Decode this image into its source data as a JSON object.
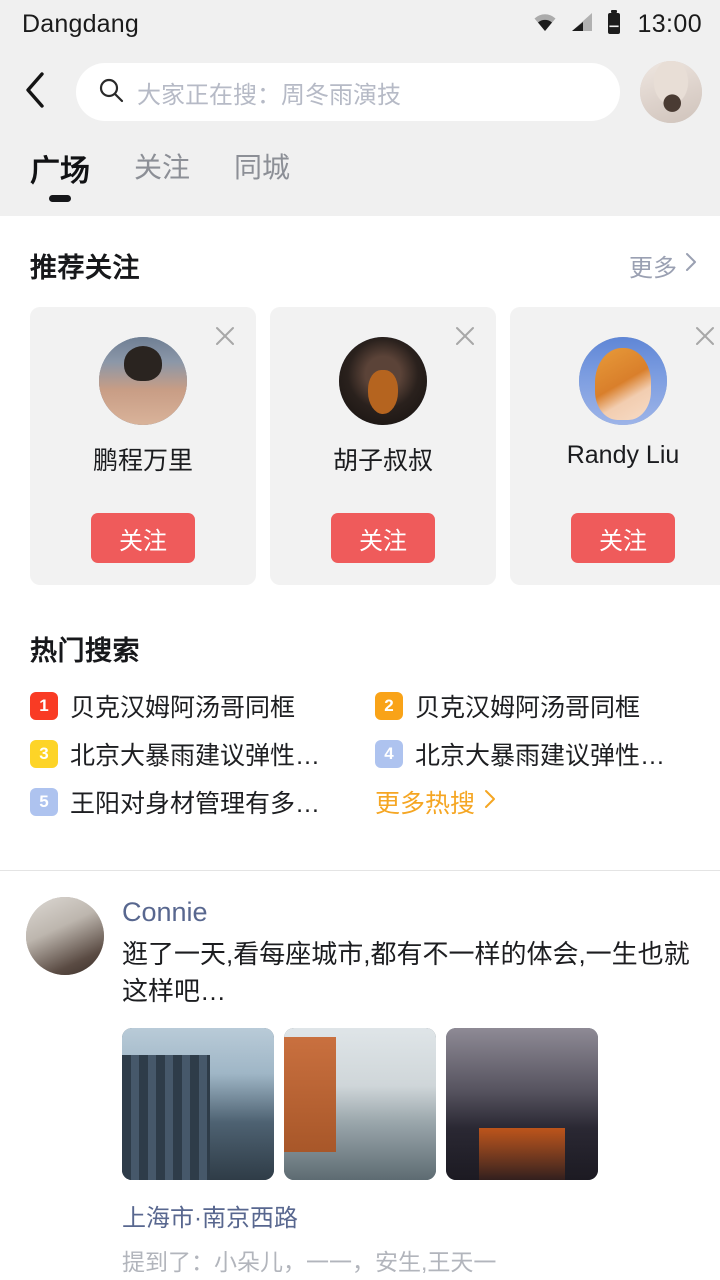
{
  "status_bar": {
    "app_title": "Dangdang",
    "time": "13:00",
    "icons": [
      "wifi-icon",
      "cellular-signal-icon",
      "battery-icon"
    ]
  },
  "header": {
    "back_icon": "back-chevron-icon",
    "search": {
      "icon": "search-icon",
      "placeholder": "大家正在搜：周冬雨演技",
      "value": ""
    },
    "profile_avatar": "user-avatar"
  },
  "tabs": [
    {
      "label": "广场",
      "active": true
    },
    {
      "label": "关注",
      "active": false
    },
    {
      "label": "同城",
      "active": false
    }
  ],
  "recommend": {
    "title": "推荐关注",
    "more_label": "更多",
    "more_icon": "chevron-right-icon",
    "close_icon": "close-icon",
    "follow_label": "关注",
    "follow_color": "#ef5b5b",
    "cards": [
      {
        "name": "鹏程万里",
        "avatar": "ph-man"
      },
      {
        "name": "胡子叔叔",
        "avatar": "ph-dwarf"
      },
      {
        "name": "Randy Liu",
        "avatar": "ph-redhead"
      }
    ]
  },
  "hot_search": {
    "title": "热门搜索",
    "more_label": "更多热搜",
    "more_icon": "chevron-right-icon",
    "more_color": "#f5a623",
    "items": [
      {
        "rank": "1",
        "text": "贝克汉姆阿汤哥同框",
        "color": "#f93b24"
      },
      {
        "rank": "2",
        "text": "贝克汉姆阿汤哥同框",
        "color": "#f9a318"
      },
      {
        "rank": "3",
        "text": "北京大暴雨建议弹性…",
        "color": "#fdd427"
      },
      {
        "rank": "4",
        "text": "北京大暴雨建议弹性…",
        "color": "#aec3ef"
      },
      {
        "rank": "5",
        "text": "王阳对身材管理有多…",
        "color": "#aec3ef"
      }
    ]
  },
  "feed": {
    "post": {
      "avatar": "ph-connie",
      "username": "Connie",
      "username_color": "#58678f",
      "text": "逛了一天,看每座城市,都有不一样的体会,一生也就这样吧…",
      "images": [
        "ph-city1",
        "ph-city2",
        "ph-city3"
      ],
      "location": "上海市·南京西路",
      "mentions": "提到了：小朵儿，一一，安生,王天一"
    }
  }
}
